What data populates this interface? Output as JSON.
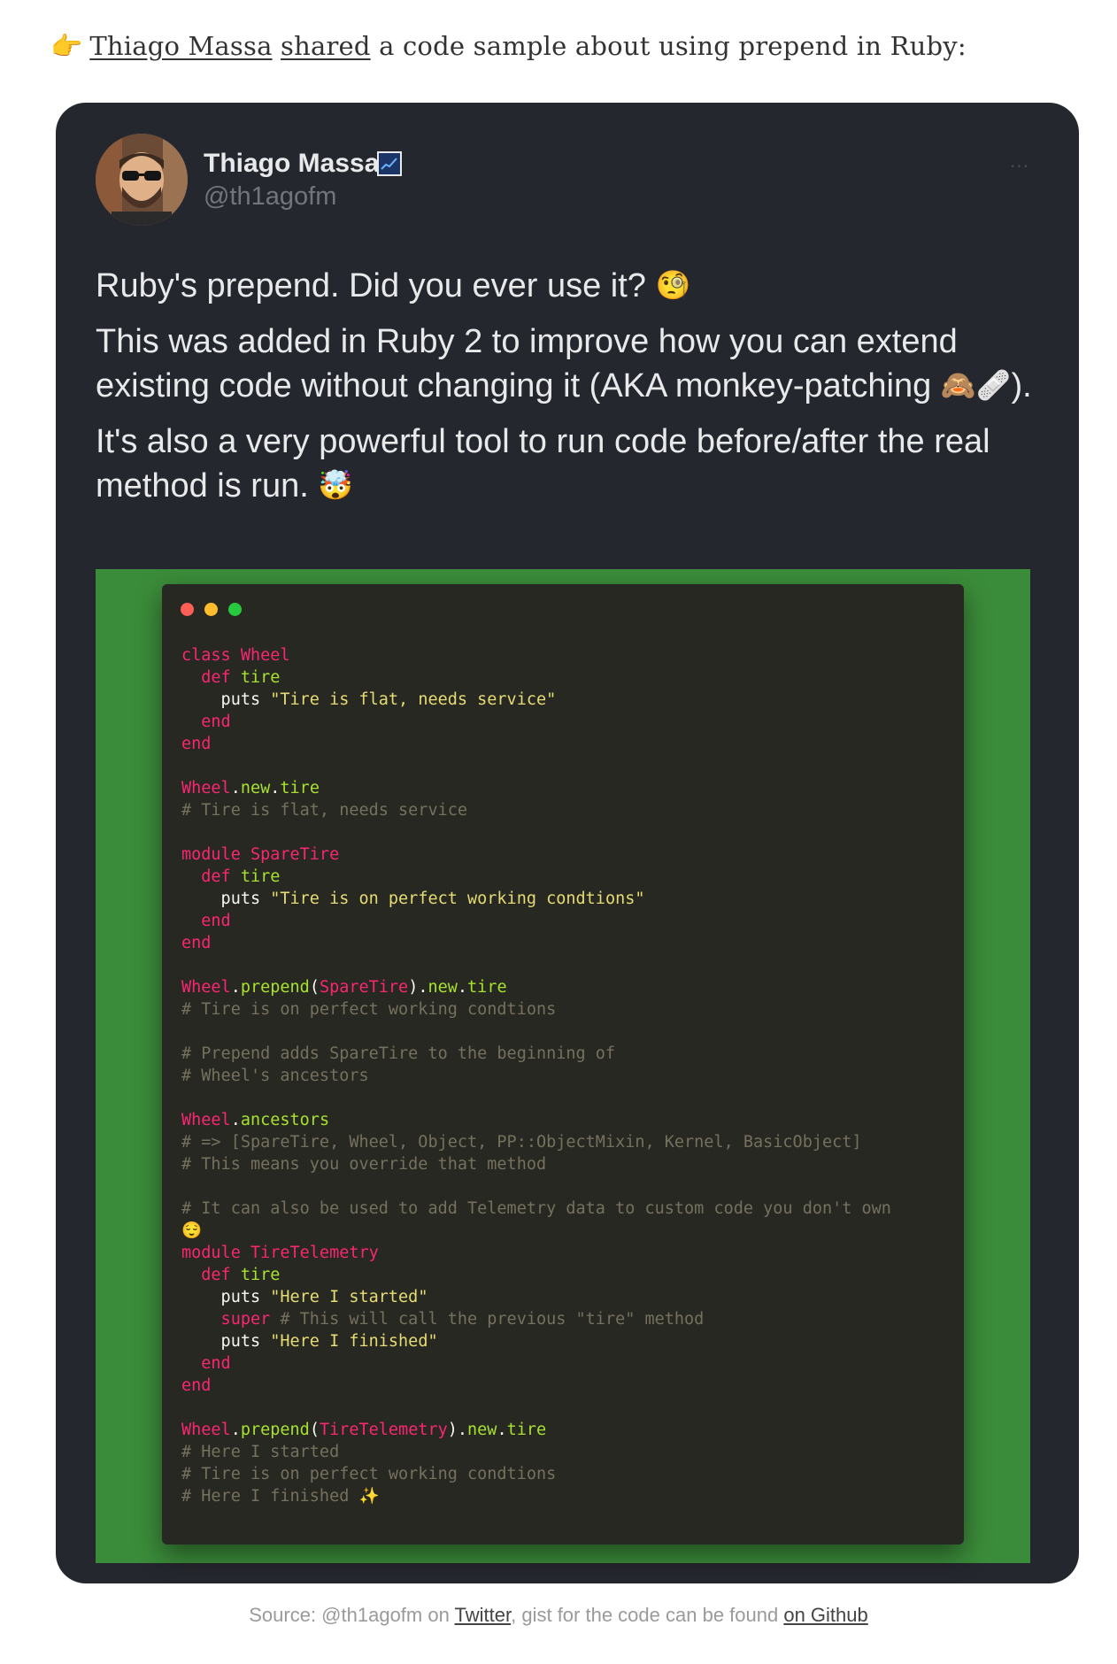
{
  "intro": {
    "pointer_emoji": "👉",
    "author_link": "Thiago Massa",
    "shared_link": "shared",
    "text_after": "a code sample about using prepend in Ruby:"
  },
  "tweet": {
    "author": {
      "name": "Thiago Massa",
      "handle": "@th1agofm",
      "badge_icon": "chart-emoji"
    },
    "more_label": "···",
    "paragraphs": [
      {
        "text": "Ruby's prepend. Did you ever use it?",
        "emoji": "🧐"
      },
      {
        "text": "This was added in Ruby 2 to improve how you can extend existing code without changing it (AKA monkey-patching",
        "emoji": "🙈🩹",
        "suffix": ")."
      },
      {
        "text": "It's also a very powerful tool to run code before/after the real method is run.",
        "emoji": "🤯"
      }
    ],
    "media": {
      "background": "#3b8c3a",
      "window_dots": [
        "#ff5f56",
        "#ffbd2e",
        "#27c93f"
      ],
      "code_lines": [
        [
          [
            "kw",
            "class "
          ],
          [
            "cn",
            "Wheel"
          ]
        ],
        [
          [
            "kw",
            "  def "
          ],
          [
            "fn",
            "tire"
          ]
        ],
        [
          [
            "pl",
            "    puts "
          ],
          [
            "st",
            "\"Tire is flat, needs service\""
          ]
        ],
        [
          [
            "kw",
            "  end"
          ]
        ],
        [
          [
            "kw",
            "end"
          ]
        ],
        [],
        [
          [
            "cn",
            "Wheel"
          ],
          [
            "pl",
            "."
          ],
          [
            "fn",
            "new"
          ],
          [
            "pl",
            "."
          ],
          [
            "fn",
            "tire"
          ]
        ],
        [
          [
            "cm",
            "# Tire is flat, needs service"
          ]
        ],
        [],
        [
          [
            "kw",
            "module "
          ],
          [
            "cn",
            "SpareTire"
          ]
        ],
        [
          [
            "kw",
            "  def "
          ],
          [
            "fn",
            "tire"
          ]
        ],
        [
          [
            "pl",
            "    puts "
          ],
          [
            "st",
            "\"Tire is on perfect working condtions\""
          ]
        ],
        [
          [
            "kw",
            "  end"
          ]
        ],
        [
          [
            "kw",
            "end"
          ]
        ],
        [],
        [
          [
            "cn",
            "Wheel"
          ],
          [
            "pl",
            "."
          ],
          [
            "fn",
            "prepend"
          ],
          [
            "pl",
            "("
          ],
          [
            "cn",
            "SpareTire"
          ],
          [
            "pl",
            ")."
          ],
          [
            "fn",
            "new"
          ],
          [
            "pl",
            "."
          ],
          [
            "fn",
            "tire"
          ]
        ],
        [
          [
            "cm",
            "# Tire is on perfect working condtions"
          ]
        ],
        [],
        [
          [
            "cm",
            "# Prepend adds SpareTire to the beginning of"
          ]
        ],
        [
          [
            "cm",
            "# Wheel's ancestors"
          ]
        ],
        [],
        [
          [
            "cn",
            "Wheel"
          ],
          [
            "pl",
            "."
          ],
          [
            "fn",
            "ancestors"
          ]
        ],
        [
          [
            "cm",
            "# => [SpareTire, Wheel, Object, PP::ObjectMixin, Kernel, BasicObject]"
          ]
        ],
        [
          [
            "cm",
            "# This means you override that method"
          ]
        ],
        [],
        [
          [
            "cm",
            "# It can also be used to add Telemetry data to custom code you don't own"
          ]
        ],
        [
          [
            "st",
            "😌"
          ]
        ],
        [
          [
            "kw",
            "module "
          ],
          [
            "cn",
            "TireTelemetry"
          ]
        ],
        [
          [
            "kw",
            "  def "
          ],
          [
            "fn",
            "tire"
          ]
        ],
        [
          [
            "pl",
            "    puts "
          ],
          [
            "st",
            "\"Here I started\""
          ]
        ],
        [
          [
            "kw",
            "    super"
          ],
          [
            "cm",
            " # This will call the previous \"tire\" method"
          ]
        ],
        [
          [
            "pl",
            "    puts "
          ],
          [
            "st",
            "\"Here I finished\""
          ]
        ],
        [
          [
            "kw",
            "  end"
          ]
        ],
        [
          [
            "kw",
            "end"
          ]
        ],
        [],
        [
          [
            "cn",
            "Wheel"
          ],
          [
            "pl",
            "."
          ],
          [
            "fn",
            "prepend"
          ],
          [
            "pl",
            "("
          ],
          [
            "cn",
            "TireTelemetry"
          ],
          [
            "pl",
            ")."
          ],
          [
            "fn",
            "new"
          ],
          [
            "pl",
            "."
          ],
          [
            "fn",
            "tire"
          ]
        ],
        [
          [
            "cm",
            "# Here I started"
          ]
        ],
        [
          [
            "cm",
            "# Tire is on perfect working condtions"
          ]
        ],
        [
          [
            "cm",
            "# Here I finished "
          ],
          [
            "st",
            "✨"
          ]
        ]
      ]
    }
  },
  "caption": {
    "prefix": "Source: @th1agofm on",
    "twitter_link": "Twitter",
    "middle": ", gist for the code can be found",
    "github_link": "on Github"
  }
}
